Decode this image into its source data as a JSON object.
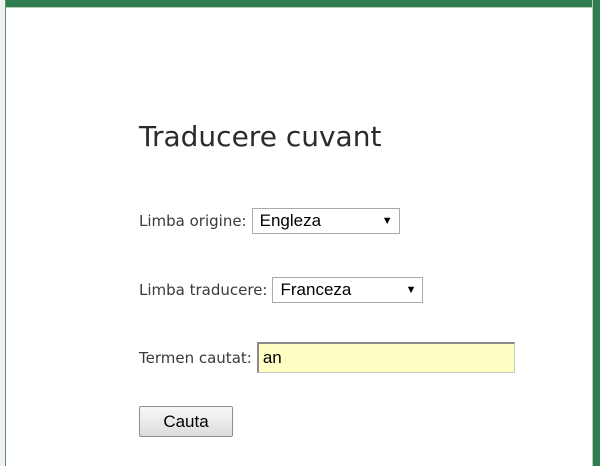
{
  "form": {
    "title": "Traducere cuvant",
    "source_language_label": "Limba origine:",
    "source_language_value": "Engleza",
    "target_language_label": "Limba traducere:",
    "target_language_value": "Franceza",
    "search_term_label": "Termen cautat:",
    "search_term_value": "an",
    "search_button_label": "Cauta"
  },
  "icons": {
    "dropdown": "triangle-down-icon"
  },
  "colors": {
    "frame_accent": "#2e7d4f",
    "input_background": "#ffffc4"
  }
}
